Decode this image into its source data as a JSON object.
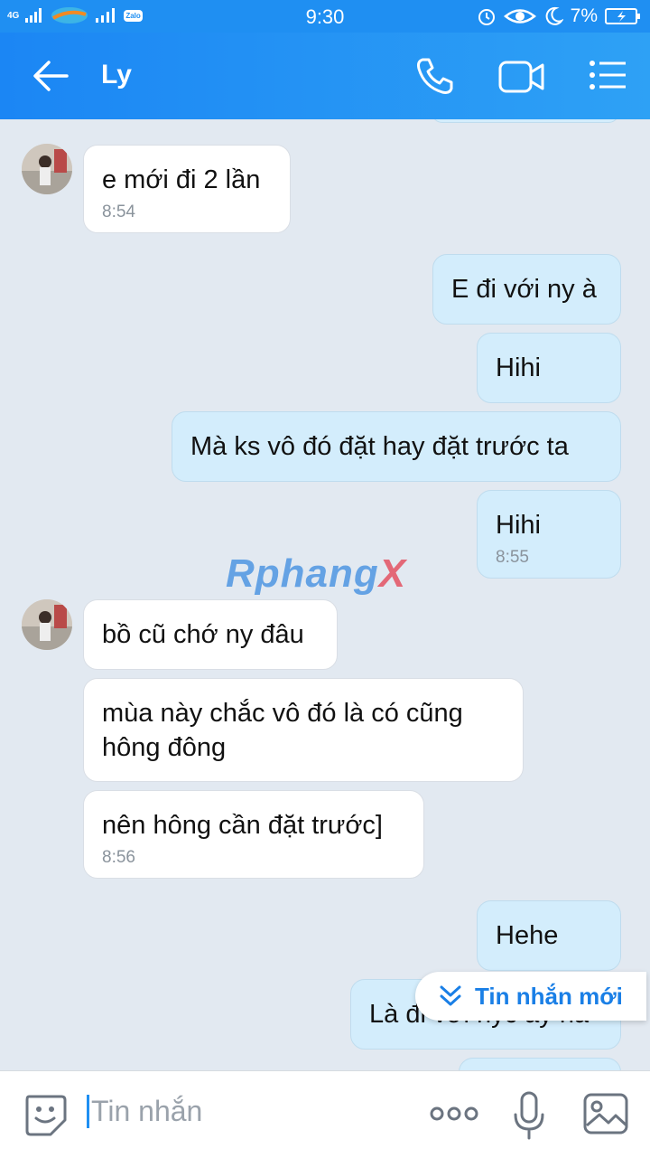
{
  "status_bar": {
    "network": "4G",
    "carrier_badge": "Zalo",
    "time": "9:30",
    "battery": "7%",
    "icons": [
      "signal-icon",
      "wifi-icon",
      "alarm-icon",
      "eye-icon",
      "moon-icon",
      "battery-icon"
    ]
  },
  "header": {
    "title": "Ly",
    "icons": [
      "back-arrow-icon",
      "phone-icon",
      "video-call-icon",
      "menu-icon"
    ]
  },
  "messages": [
    {
      "side": "in",
      "text": "e mới đi 2 lần",
      "time": "8:54"
    },
    {
      "side": "out",
      "text": "E đi với ny à"
    },
    {
      "side": "out",
      "text": "Hihi"
    },
    {
      "side": "out",
      "text": "Mà ks vô đó đặt hay đặt trước ta"
    },
    {
      "side": "out",
      "text": "Hihi",
      "time": "8:55"
    },
    {
      "side": "in",
      "text": "bồ cũ chớ ny đâu"
    },
    {
      "side": "in",
      "text": "mùa này chắc vô đó là có cũng\nhông đông"
    },
    {
      "side": "in",
      "text": "nên hông cần đặt trước]",
      "time": "8:56"
    },
    {
      "side": "out",
      "text": "Hehe"
    },
    {
      "side": "out",
      "text": "Là đi với nyc ấy ha"
    }
  ],
  "watermark": {
    "text_a": "Rphang",
    "text_b": "X"
  },
  "new_message_toast": {
    "label": "Tin nhắn mới",
    "icon": "double-chevron-down-icon"
  },
  "composer": {
    "placeholder": "Tin nhắn",
    "icons": [
      "sticker-icon",
      "more-icon",
      "microphone-icon",
      "image-icon"
    ]
  }
}
